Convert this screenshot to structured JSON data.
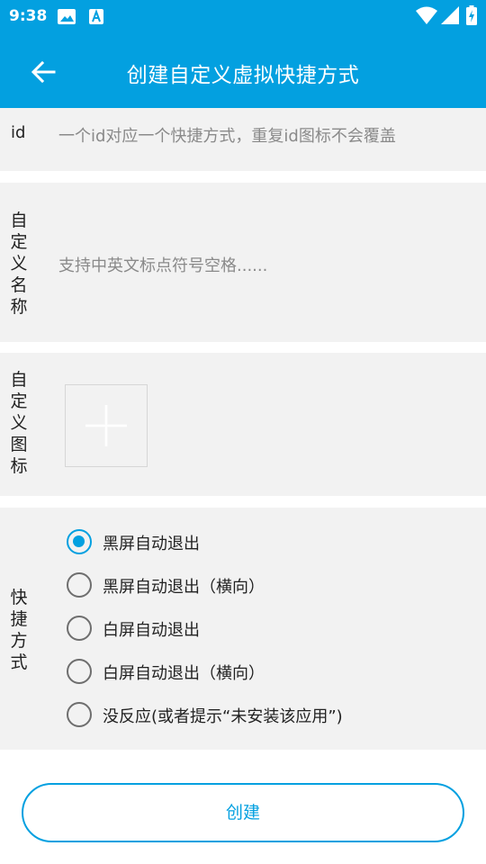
{
  "status_bar": {
    "time": "9:38",
    "icons": [
      "image-icon",
      "text-a-icon",
      "wifi-icon",
      "cell-signal-icon",
      "battery-charging-icon"
    ]
  },
  "toolbar": {
    "back_icon": "arrow-left-icon",
    "title": "创建自定义虚拟快捷方式"
  },
  "id_field": {
    "label": "id",
    "placeholder": "一个id对应一个快捷方式，重复id图标不会覆盖"
  },
  "name_field": {
    "label_chars": [
      "自",
      "定",
      "义",
      "名",
      "称"
    ],
    "placeholder": "支持中英文标点符号空格......"
  },
  "icon_field": {
    "label_chars": [
      "自",
      "定",
      "义",
      "图",
      "标"
    ],
    "add_icon": "plus-icon"
  },
  "mode_field": {
    "label_chars": [
      "快",
      "捷",
      "方",
      "式"
    ],
    "options": [
      {
        "label": "黑屏自动退出",
        "checked": true
      },
      {
        "label": "黑屏自动退出（横向）",
        "checked": false
      },
      {
        "label": "白屏自动退出",
        "checked": false
      },
      {
        "label": "白屏自动退出（横向）",
        "checked": false
      },
      {
        "label": "没反应(或者提示“未安装该应用”)",
        "checked": false
      }
    ]
  },
  "create_button": {
    "label": "创建"
  },
  "colors": {
    "accent": "#03a0e0",
    "panel": "#f2f2f2",
    "placeholder": "#8a8a8a"
  }
}
